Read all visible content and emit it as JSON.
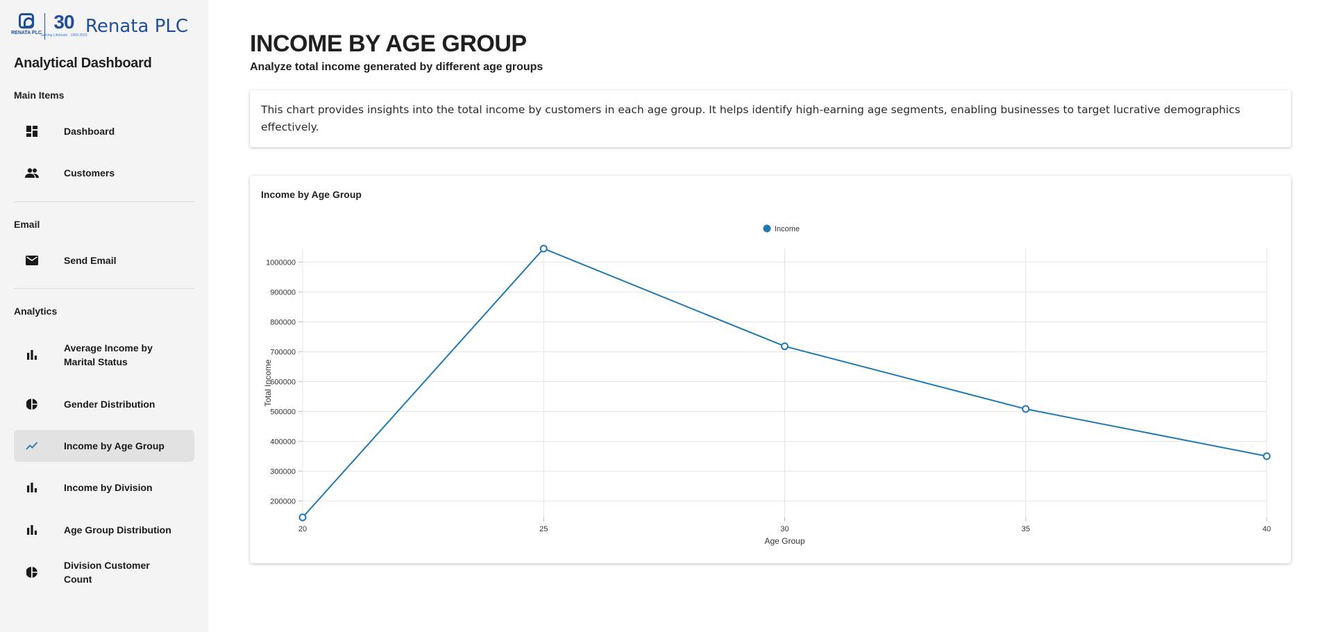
{
  "brand": {
    "logo_text": "RENATA PLC",
    "anniversary_number": "30",
    "anniversary_sub": "Serving Lifeboats · 1993-2023",
    "name": "Renata PLC"
  },
  "sidebar": {
    "title": "Analytical Dashboard",
    "sections": [
      {
        "label": "Main Items",
        "items": [
          {
            "label": "Dashboard",
            "icon": "dashboard-icon"
          },
          {
            "label": "Customers",
            "icon": "people-icon"
          }
        ]
      },
      {
        "label": "Email",
        "items": [
          {
            "label": "Send Email",
            "icon": "email-icon"
          }
        ]
      },
      {
        "label": "Analytics",
        "items": [
          {
            "label": "Average Income by Marital Status",
            "icon": "bar-chart-icon"
          },
          {
            "label": "Gender Distribution",
            "icon": "pie-chart-icon"
          },
          {
            "label": "Income by Age Group",
            "icon": "line-chart-icon",
            "active": true
          },
          {
            "label": "Income by Division",
            "icon": "bar-chart-icon"
          },
          {
            "label": "Age Group Distribution",
            "icon": "bar-chart-icon"
          },
          {
            "label": "Division Customer Count",
            "icon": "pie-chart-icon"
          }
        ]
      }
    ]
  },
  "main": {
    "title": "INCOME BY AGE GROUP",
    "subtitle": "Analyze total income generated by different age groups",
    "description": "This chart provides insights into the total income by customers in each age group. It helps identify high-earning age segments, enabling businesses to target lucrative demographics effectively.",
    "chart_card_title": "Income by Age Group"
  },
  "colors": {
    "accent": "#1f77b4",
    "brand": "#1f4e9a",
    "sidebar_bg": "#f4f4f4",
    "active_item_bg": "#e2e2e2"
  },
  "chart_data": {
    "type": "line",
    "title": "Income by Age Group",
    "xlabel": "Age Group",
    "ylabel": "Total Income",
    "x": [
      20,
      25,
      30,
      35,
      40
    ],
    "series": [
      {
        "name": "Income",
        "values": [
          145000,
          1045000,
          718000,
          508000,
          350000
        ]
      }
    ],
    "y_ticks": [
      200000,
      300000,
      400000,
      500000,
      600000,
      700000,
      800000,
      900000,
      1000000
    ],
    "ylim": [
      145000,
      1045000
    ],
    "grid": true,
    "legend": "top-center"
  }
}
